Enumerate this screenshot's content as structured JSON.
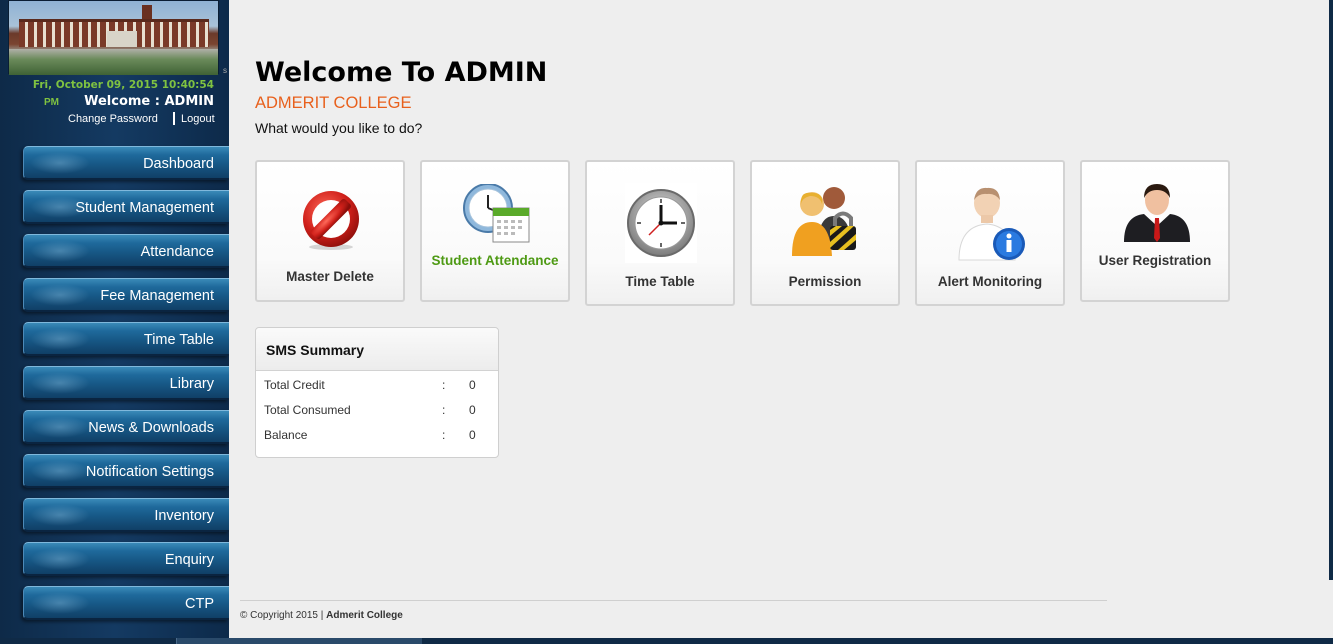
{
  "sidebar": {
    "datetime": "Fri, October 09, 2015 10:40:54",
    "ampm": "PM",
    "welcome": "Welcome : ADMIN",
    "change_password": "Change Password",
    "logout": "Logout",
    "side_mark": "s",
    "items": [
      {
        "label": "Dashboard"
      },
      {
        "label": "Student Management"
      },
      {
        "label": "Attendance"
      },
      {
        "label": "Fee Management"
      },
      {
        "label": "Time Table"
      },
      {
        "label": "Library"
      },
      {
        "label": "News & Downloads"
      },
      {
        "label": "Notification Settings"
      },
      {
        "label": "Inventory"
      },
      {
        "label": "Enquiry"
      },
      {
        "label": "CTP"
      }
    ]
  },
  "main": {
    "title": "Welcome To ADMIN",
    "college": "ADMERIT COLLEGE",
    "question": "What would you like to do?",
    "tiles": [
      {
        "label": "Master Delete",
        "icon": "no-entry-icon"
      },
      {
        "label": "Student Attendance",
        "icon": "clock-calendar-icon"
      },
      {
        "label": "Time Table",
        "icon": "clock-icon"
      },
      {
        "label": "Permission",
        "icon": "users-lock-icon"
      },
      {
        "label": "Alert Monitoring",
        "icon": "user-info-icon"
      },
      {
        "label": "User Registration",
        "icon": "businessman-icon"
      }
    ],
    "sms": {
      "title": "SMS Summary",
      "rows": [
        {
          "key": "Total Credit",
          "sep": ":",
          "value": "0"
        },
        {
          "key": "Total Consumed",
          "sep": ":",
          "value": "0"
        },
        {
          "key": "Balance",
          "sep": ":",
          "value": "0"
        }
      ]
    }
  },
  "footer": {
    "copyright": "© Copyright 2015 |",
    "org": "Admerit College"
  },
  "colors": {
    "accent": "#e8601c",
    "sidebar": "#143a62",
    "green": "#7fc241"
  }
}
